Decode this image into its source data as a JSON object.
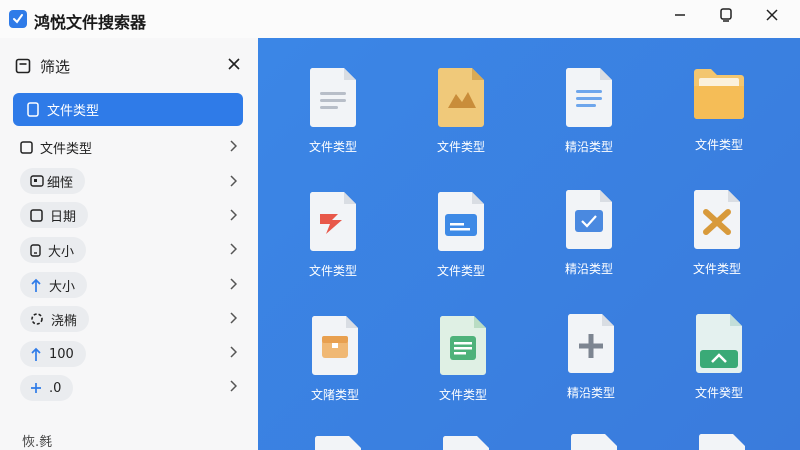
{
  "window": {
    "title": "鸿悦文件搜索器",
    "controls": [
      "minimize",
      "maximize",
      "close"
    ]
  },
  "sidebar": {
    "header": "筛选",
    "active_item": {
      "label": "文件类型",
      "icon": "file-icon"
    },
    "items": [
      {
        "label": "文件类型",
        "icon": "square-icon"
      },
      {
        "label": "细恎",
        "icon": "tag-icon"
      },
      {
        "label": "日期",
        "icon": "square-icon"
      },
      {
        "label": "大小",
        "icon": "phone-icon"
      },
      {
        "label": "大小",
        "icon": "upload-arrow-icon"
      },
      {
        "label": "浇椭",
        "icon": "spinner-icon"
      },
      {
        "label": "100",
        "icon": "upload-arrow-icon"
      },
      {
        "label": ".0",
        "icon": "plus-icon"
      }
    ],
    "footer": "恢.毵"
  },
  "grid": {
    "tiles": [
      {
        "caption": "文件类型",
        "icon": "text-doc-icon"
      },
      {
        "caption": "文件类型",
        "icon": "image-doc-icon"
      },
      {
        "caption": "精沿类型",
        "icon": "text-doc-icon"
      },
      {
        "caption": "文件类型",
        "icon": "folder-icon"
      },
      {
        "caption": "文件类型",
        "icon": "pdf-doc-icon"
      },
      {
        "caption": "文件类型",
        "icon": "folder-doc-icon"
      },
      {
        "caption": "精沿类型",
        "icon": "check-doc-icon"
      },
      {
        "caption": "文件类型",
        "icon": "tools-doc-icon"
      },
      {
        "caption": "文陼类型",
        "icon": "archive-doc-icon"
      },
      {
        "caption": "文件类型",
        "icon": "sheet-doc-icon"
      },
      {
        "caption": "精沿类型",
        "icon": "plus-doc-icon"
      },
      {
        "caption": "文件癸型",
        "icon": "image-up-doc-icon"
      }
    ]
  },
  "colors": {
    "accent": "#2f7be8",
    "grid_bg": "#3a80e2"
  }
}
